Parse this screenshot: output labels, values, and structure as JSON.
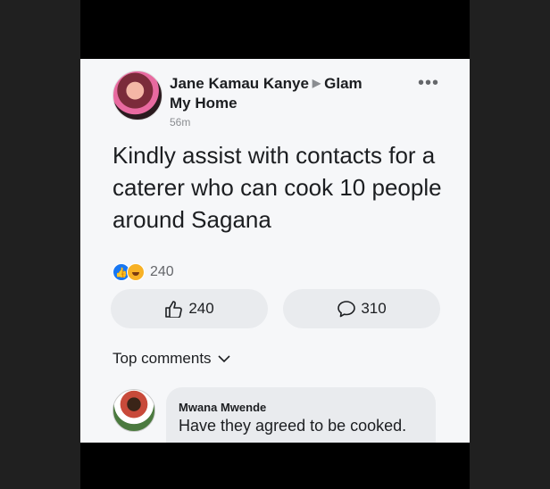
{
  "post": {
    "author": "Jane Kamau Kanye",
    "group": "Glam",
    "group_line2": "My Home",
    "time": "56m",
    "text": "Kindly assist with contacts for a caterer who can cook 10 people around Sagana",
    "reaction_count": "240",
    "like_count": "240",
    "comment_count": "310",
    "icons": {
      "like": "like-reaction-icon",
      "haha": "haha-reaction-icon",
      "thumb": "thumbs-up-icon",
      "comment": "comment-bubble-icon",
      "more": "more-options-icon"
    },
    "colors": {
      "like_blue": "#1877f2",
      "haha_yellow": "#f7b125"
    }
  },
  "comments": {
    "header": "Top comments",
    "items": [
      {
        "name": "Mwana Mwende",
        "text": "Have they agreed to be cooked."
      }
    ]
  }
}
